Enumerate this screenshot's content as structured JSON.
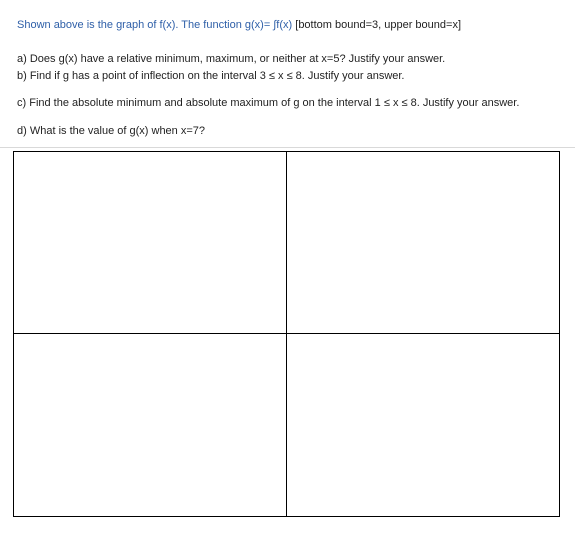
{
  "intro": {
    "lead": "Shown above is the graph of f(x). The function g(x)= ∫f(x)",
    "bounds": " [bottom bound=3, upper bound=x]"
  },
  "questions": {
    "a": "a) Does g(x) have a relative minimum, maximum, or neither at x=5? Justify your answer.",
    "b": "b) Find if g has a point of inflection on the interval 3 ≤ x ≤ 8. Justify your answer.",
    "c": "c) Find the absolute minimum and absolute maximum of g on the interval 1 ≤ x ≤ 8. Justify your answer.",
    "d": "d) What is the value of g(x) when x=7?"
  },
  "answer_grid": {
    "cells": [
      "",
      "",
      "",
      ""
    ]
  }
}
